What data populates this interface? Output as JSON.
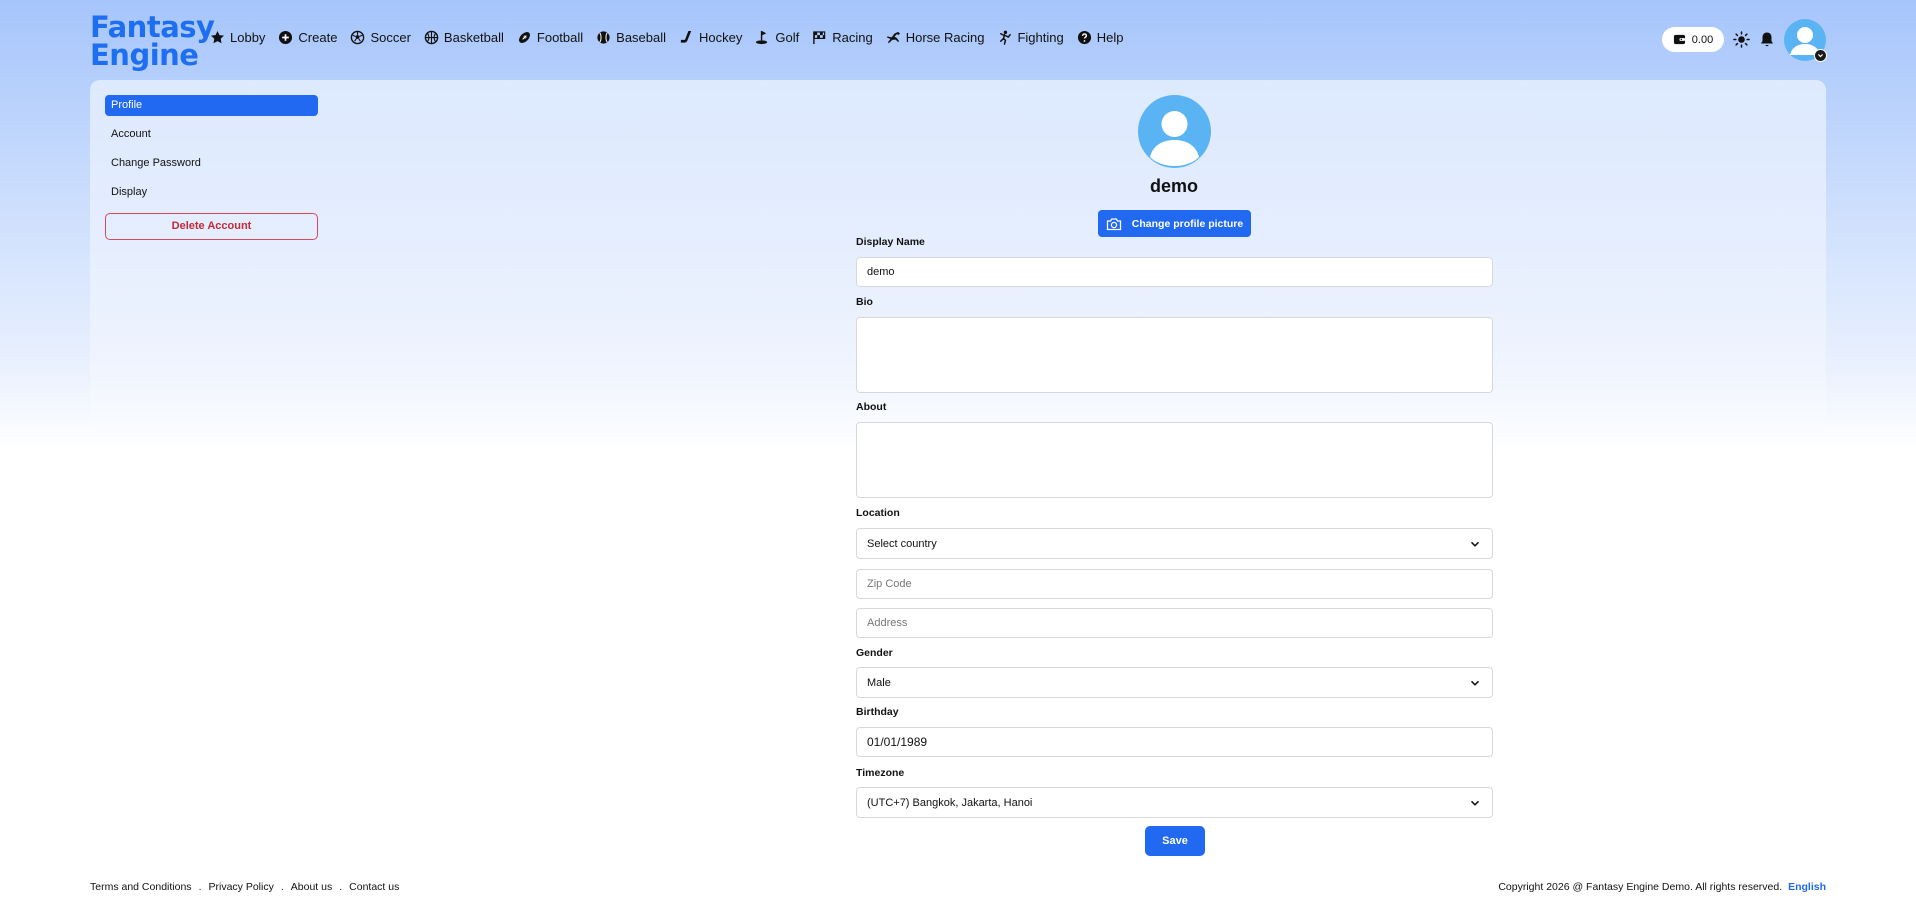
{
  "brand": {
    "line1": "Fantasy",
    "line2": "Engine",
    "color": "#1d6ef0"
  },
  "nav": [
    {
      "label": "Lobby",
      "icon": "star-icon"
    },
    {
      "label": "Create",
      "icon": "plus-circle-icon"
    },
    {
      "label": "Soccer",
      "icon": "soccer-ball-icon"
    },
    {
      "label": "Basketball",
      "icon": "basketball-icon"
    },
    {
      "label": "Football",
      "icon": "football-icon"
    },
    {
      "label": "Baseball",
      "icon": "baseball-icon"
    },
    {
      "label": "Hockey",
      "icon": "hockey-stick-icon"
    },
    {
      "label": "Golf",
      "icon": "golf-icon"
    },
    {
      "label": "Racing",
      "icon": "checkered-flag-icon"
    },
    {
      "label": "Horse Racing",
      "icon": "horse-icon"
    },
    {
      "label": "Fighting",
      "icon": "fighter-icon"
    },
    {
      "label": "Help",
      "icon": "question-circle-icon"
    }
  ],
  "header": {
    "wallet_balance": "0.00"
  },
  "sidebar": {
    "items": [
      {
        "label": "Profile",
        "active": true
      },
      {
        "label": "Account",
        "active": false
      },
      {
        "label": "Change Password",
        "active": false
      },
      {
        "label": "Display",
        "active": false
      }
    ],
    "delete_label": "Delete Account"
  },
  "profile": {
    "username": "demo",
    "change_picture_label": "Change profile picture"
  },
  "form": {
    "display_name_label": "Display Name",
    "display_name_value": "demo",
    "bio_label": "Bio",
    "bio_value": "",
    "about_label": "About",
    "about_value": "",
    "location_label": "Location",
    "country_value": "Select country",
    "zip_placeholder": "Zip Code",
    "address_placeholder": "Address",
    "gender_label": "Gender",
    "gender_value": "Male",
    "birthday_label": "Birthday",
    "birthday_value": "01/01/1989",
    "timezone_label": "Timezone",
    "timezone_value": "(UTC+7) Bangkok, Jakarta, Hanoi",
    "save_label": "Save"
  },
  "footer": {
    "links": [
      "Terms and Conditions",
      "Privacy Policy",
      "About us",
      "Contact us"
    ],
    "separator": ".",
    "copyright": "Copyright 2026 @ Fantasy Engine Demo. All rights reserved.",
    "language": "English"
  },
  "colors": {
    "primary": "#2069f0",
    "danger": "#c52a3a",
    "avatar": "#5ab4f4"
  }
}
